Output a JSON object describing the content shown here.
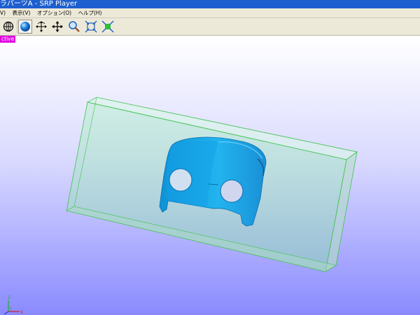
{
  "window": {
    "title": "ラパーツA - SRP Player"
  },
  "menu": {
    "items": [
      "V)",
      "表示(V)",
      "オプション(O)",
      "ヘルプ(H)"
    ]
  },
  "toolbar": {
    "buttons": [
      {
        "icon": "globe-icon"
      },
      {
        "icon": "sphere-icon"
      },
      {
        "icon": "rotate-icon"
      },
      {
        "icon": "pan-icon"
      },
      {
        "icon": "zoom-icon"
      },
      {
        "icon": "fit-icon"
      },
      {
        "icon": "fit-green-icon"
      }
    ]
  },
  "viewport": {
    "badge": "ctive",
    "axis": {
      "labels": [
        "Z",
        "Y",
        "X"
      ]
    }
  },
  "colors": {
    "titlebar": "#1e5fcf",
    "toolbar_bg": "#ece9d8",
    "badge": "#e100e1",
    "model": "#1aa3ea",
    "box_edge": "#39c04a"
  }
}
